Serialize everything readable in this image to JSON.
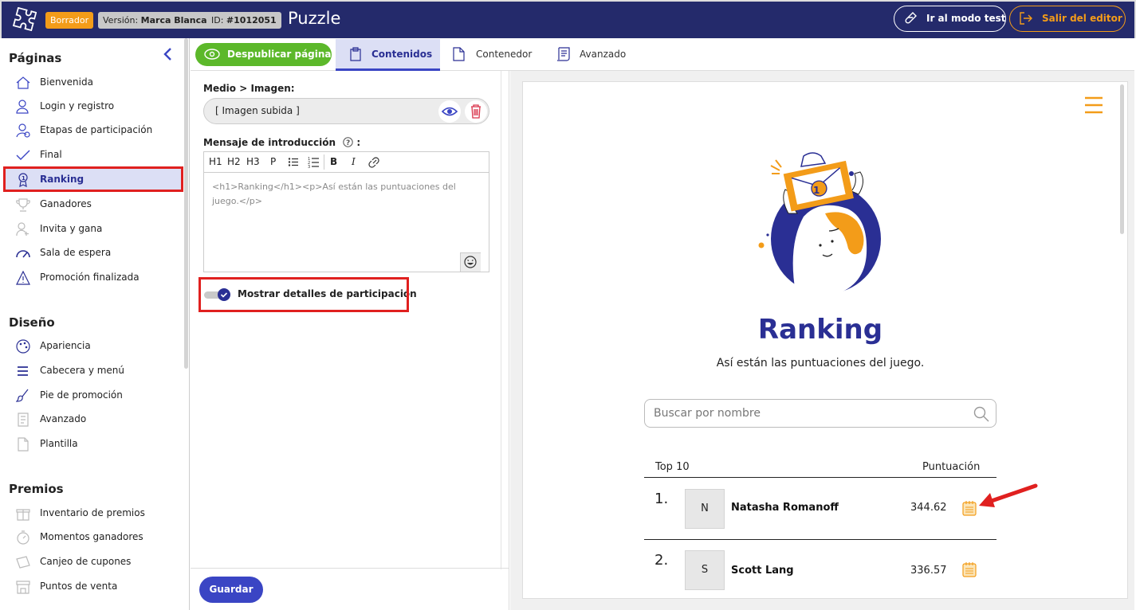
{
  "header": {
    "status_badge": "Borrador",
    "version_label": "Versión:",
    "version_value": "Marca Blanca",
    "id_label": "ID:",
    "id_value": "#1012051",
    "app_title": "Puzzle",
    "test_mode_button": "Ir al modo test",
    "exit_editor_button": "Salir del editor"
  },
  "sidebar": {
    "pages_title": "Páginas",
    "pages": [
      {
        "label": "Bienvenida",
        "icon": "home-icon"
      },
      {
        "label": "Login y registro",
        "icon": "user-login-icon"
      },
      {
        "label": "Etapas de participación",
        "icon": "user-steps-icon"
      },
      {
        "label": "Final",
        "icon": "check-icon"
      },
      {
        "label": "Ranking",
        "icon": "medal-icon",
        "active": true
      },
      {
        "label": "Ganadores",
        "icon": "trophy-icon"
      },
      {
        "label": "Invita y gana",
        "icon": "invite-icon"
      },
      {
        "label": "Sala de espera",
        "icon": "speedometer-icon"
      },
      {
        "label": "Promoción finalizada",
        "icon": "warning-icon"
      }
    ],
    "design_title": "Diseño",
    "design": [
      {
        "label": "Apariencia",
        "icon": "palette-icon"
      },
      {
        "label": "Cabecera y menú",
        "icon": "menu-icon"
      },
      {
        "label": "Pie de promoción",
        "icon": "brush-icon"
      },
      {
        "label": "Avanzado",
        "icon": "code-doc-icon"
      },
      {
        "label": "Plantilla",
        "icon": "document-icon"
      }
    ],
    "prizes_title": "Premios",
    "prizes": [
      {
        "label": "Inventario de premios",
        "icon": "gift-icon"
      },
      {
        "label": "Momentos ganadores",
        "icon": "stopwatch-icon"
      },
      {
        "label": "Canjeo de cupones",
        "icon": "coupon-icon"
      },
      {
        "label": "Puntos de venta",
        "icon": "store-icon"
      }
    ]
  },
  "toolbar": {
    "unpublish_button": "Despublicar página",
    "tabs": [
      "Contenidos",
      "Contenedor",
      "Avanzado"
    ],
    "active_tab": "Contenidos"
  },
  "editor": {
    "media_label": "Medio > Imagen:",
    "media_value": "[ Imagen subida ]",
    "intro_label": "Mensaje de introducción",
    "intro_colon": ":",
    "rte_tools": [
      "H1",
      "H2",
      "H3",
      "P",
      "B",
      "I"
    ],
    "intro_value": "<h1>Ranking</h1><p>Así están las puntuaciones del juego.</p>",
    "show_details_label": "Mostrar detalles de participación",
    "show_details_checked": true,
    "save_button": "Guardar"
  },
  "preview": {
    "title": "Ranking",
    "subtitle": "Así están las puntuaciones del juego.",
    "search_placeholder": "Buscar por nombre",
    "col_top": "Top 10",
    "col_score": "Puntuación",
    "rows": [
      {
        "rank": "1.",
        "initial": "N",
        "name": "Natasha Romanoff",
        "score": "344.62"
      },
      {
        "rank": "2.",
        "initial": "S",
        "name": "Scott Lang",
        "score": "336.57"
      }
    ],
    "accent_color": "#2a2f94",
    "highlight_color": "#e0201f",
    "illustration_badge": "1"
  }
}
